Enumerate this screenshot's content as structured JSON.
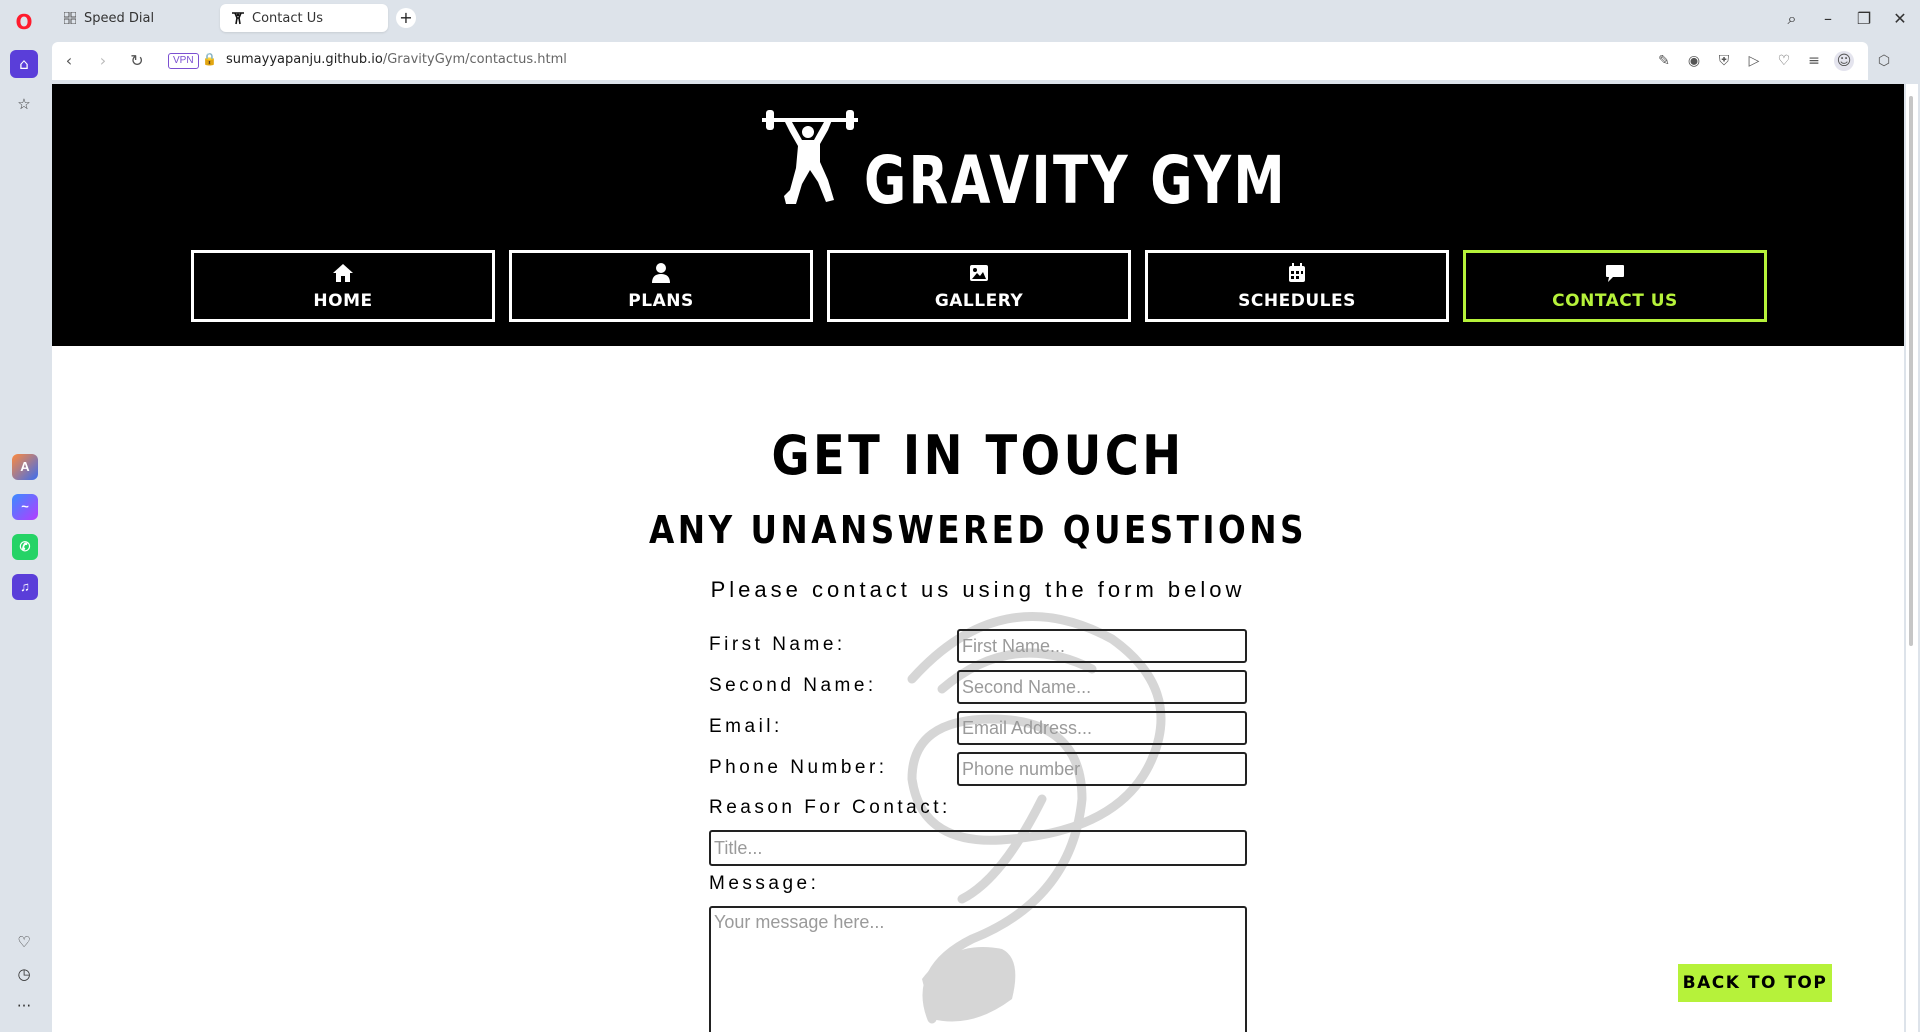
{
  "browser": {
    "tabs": [
      {
        "title": "Speed Dial",
        "icon": "grid-icon",
        "active": false
      },
      {
        "title": "Contact Us",
        "icon": "weightlifter-icon",
        "active": true
      }
    ],
    "vpn_label": "VPN",
    "url_host": "sumayyapanju.github.io",
    "url_path": "/GravityGym/contactus.html",
    "accent_color": "#5a3ed9"
  },
  "site": {
    "brand": "GRAVITY GYM",
    "accent_color": "#b6f23a",
    "nav": [
      {
        "label": "HOME",
        "icon": "home-icon"
      },
      {
        "label": "PLANS",
        "icon": "user-icon"
      },
      {
        "label": "GALLERY",
        "icon": "image-icon"
      },
      {
        "label": "SCHEDULES",
        "icon": "calendar-icon"
      },
      {
        "label": "CONTACT US",
        "icon": "comment-icon",
        "current": true
      }
    ]
  },
  "main": {
    "heading": "GET IN TOUCH",
    "subheading": "ANY UNANSWERED QUESTIONS",
    "lead": "Please contact us using the form below",
    "form": {
      "first_name_label": "First Name:",
      "first_name_placeholder": "First Name...",
      "second_name_label": "Second Name:",
      "second_name_placeholder": "Second Name...",
      "email_label": "Email:",
      "email_placeholder": "Email Address...",
      "phone_label": "Phone Number:",
      "phone_placeholder": "Phone number",
      "reason_label": "Reason For Contact:",
      "reason_placeholder": "Title...",
      "message_label": "Message:",
      "message_placeholder": "Your message here..."
    },
    "back_to_top": "BACK TO TOP"
  }
}
